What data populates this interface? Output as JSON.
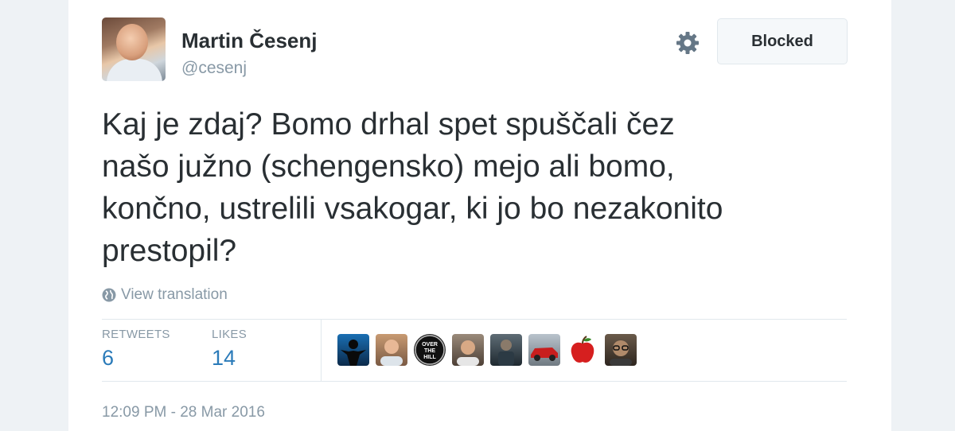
{
  "author": {
    "name": "Martin Česenj",
    "handle": "@cesenj"
  },
  "actions": {
    "blocked_label": "Blocked"
  },
  "tweet": {
    "lines": [
      "Kaj je zdaj? Bomo drhal spet spuščali čez",
      "našo južno (schengensko) mejo ali bomo,",
      "končno, ustrelili vsakogar, ki jo bo nezakonito",
      "prestopil?"
    ],
    "translate_label": "View translation",
    "timestamp": "12:09 PM - 28 Mar 2016"
  },
  "stats": {
    "retweets_label": "RETWEETS",
    "retweets_value": "6",
    "likes_label": "LIKES",
    "likes_value": "14"
  },
  "likers": [
    {
      "icon": "silhouette-avatar"
    },
    {
      "icon": "man-avatar"
    },
    {
      "icon": "over-the-hill-logo",
      "text": "OVER THE HILL"
    },
    {
      "icon": "man-avatar"
    },
    {
      "icon": "person-avatar"
    },
    {
      "icon": "red-car-avatar"
    },
    {
      "icon": "apple-avatar"
    },
    {
      "icon": "man-glasses-avatar"
    }
  ],
  "colors": {
    "link_blue": "#2b7bb9",
    "muted_gray": "#8899a6",
    "text_dark": "#292f33"
  }
}
